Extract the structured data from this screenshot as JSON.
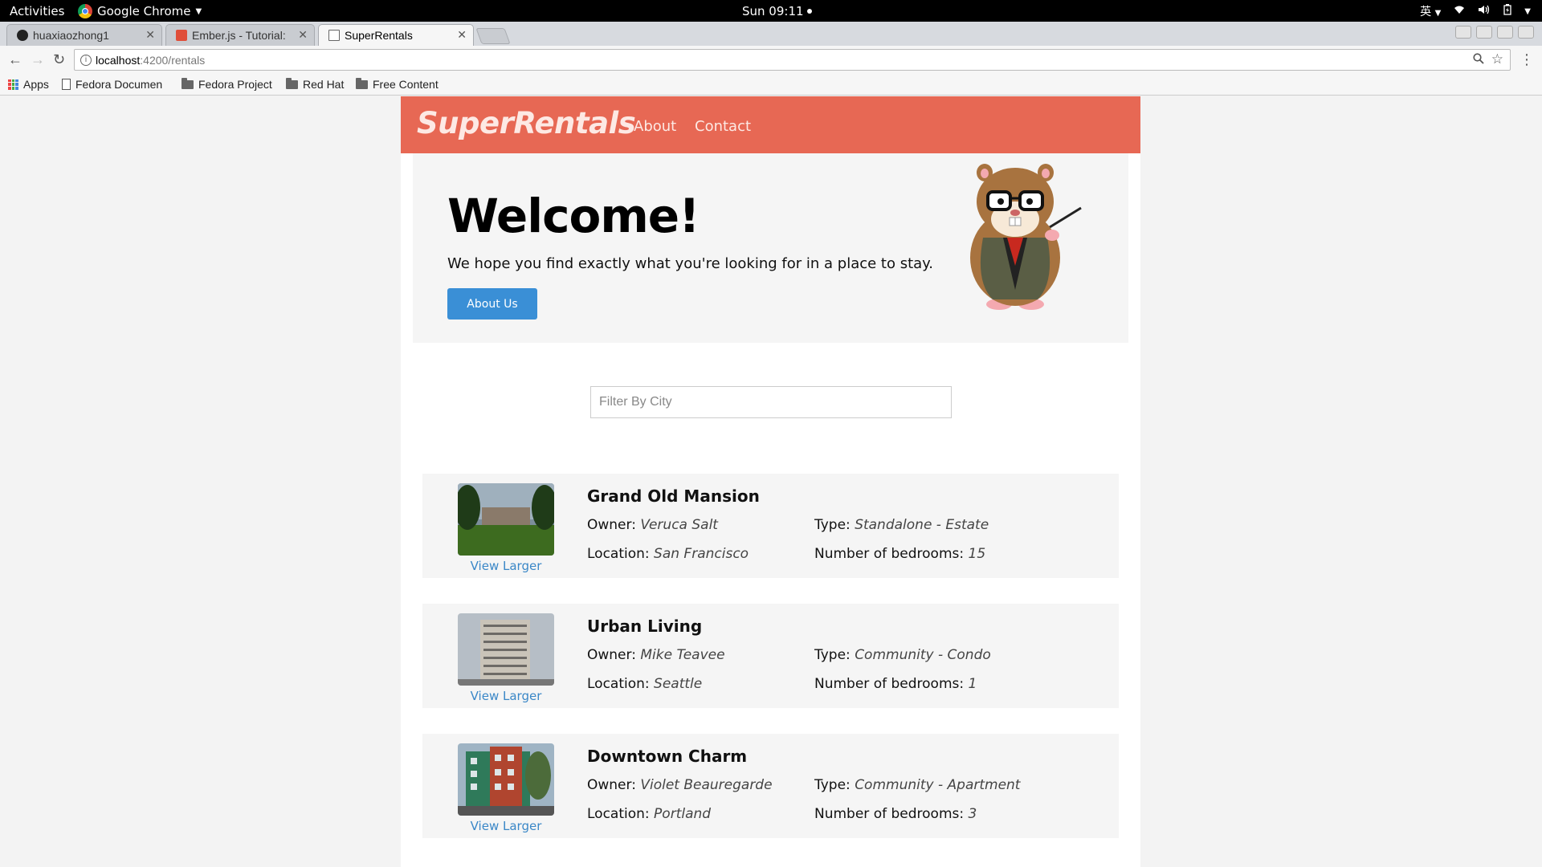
{
  "system_bar": {
    "activities": "Activities",
    "app_name": "Google Chrome",
    "clock": "Sun 09:11",
    "input_method": "英"
  },
  "browser": {
    "tabs": [
      {
        "label": "huaxiaozhong1",
        "icon": "github-icon"
      },
      {
        "label": "Ember.js - Tutorial:",
        "icon": "ember-icon"
      },
      {
        "label": "SuperRentals",
        "icon": "page-icon"
      }
    ],
    "url_host": "localhost",
    "url_path": ":4200/rentals",
    "bookmarks": [
      "Apps",
      "Fedora Documen",
      "Fedora Project",
      "Red Hat",
      "Free Content"
    ]
  },
  "app": {
    "brand": "SuperRentals",
    "nav": [
      "About",
      "Contact"
    ],
    "accent_color": "#e76854"
  },
  "jumbo": {
    "title": "Welcome!",
    "lead": "We hope you find exactly what you're looking for in a place to stay.",
    "button": "About Us"
  },
  "filter": {
    "placeholder": "Filter By City"
  },
  "labels": {
    "owner": "Owner:",
    "location": "Location:",
    "type": "Type:",
    "bedrooms": "Number of bedrooms:",
    "view_larger": "View Larger"
  },
  "rentals": [
    {
      "title": "Grand Old Mansion",
      "owner": "Veruca Salt",
      "location": "San Francisco",
      "type": "Standalone - Estate",
      "bedrooms": "15"
    },
    {
      "title": "Urban Living",
      "owner": "Mike Teavee",
      "location": "Seattle",
      "type": "Community - Condo",
      "bedrooms": "1"
    },
    {
      "title": "Downtown Charm",
      "owner": "Violet Beauregarde",
      "location": "Portland",
      "type": "Community - Apartment",
      "bedrooms": "3"
    }
  ]
}
